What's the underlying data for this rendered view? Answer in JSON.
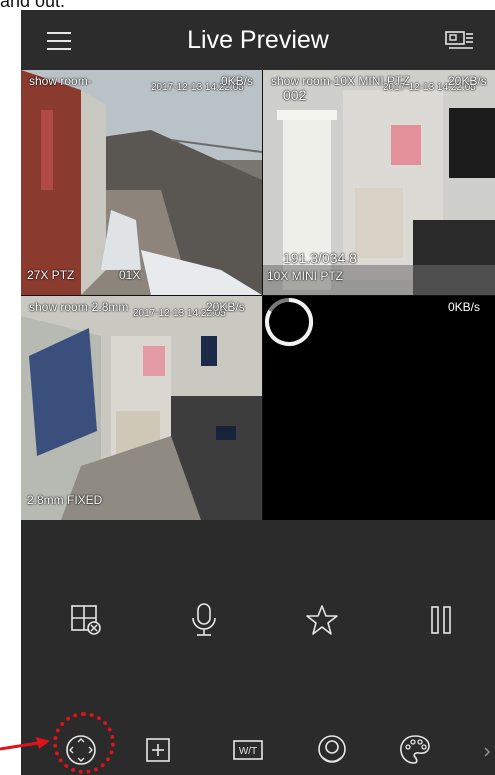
{
  "caption": "and out.",
  "header": {
    "title": "Live Preview",
    "menu_icon": "hamburger-menu-icon",
    "device_icon": "device-list-icon"
  },
  "cameras": [
    {
      "name": "show room-",
      "timestamp": "2017-12-13 14:22:05",
      "bitrate": "0KB/s",
      "label": "27X PTZ",
      "sub_label": "01X"
    },
    {
      "name": "show room-10X MINI PTZ",
      "timestamp": "2017-12-13 14:22:05",
      "bitrate": "20KB/s",
      "channel": "002",
      "label": "10X MINI PTZ",
      "coords": "191.3/034.8"
    },
    {
      "name": "show room-2.8mm",
      "timestamp": "2017-12-13 14:22:05",
      "bitrate": "20KB/s",
      "label": "2.8mm FIXED"
    },
    {
      "name": "",
      "bitrate": "0KB/s",
      "loading": true
    }
  ],
  "controls_row1": [
    {
      "icon": "close-window-icon"
    },
    {
      "icon": "microphone-icon"
    },
    {
      "icon": "star-favorite-icon"
    },
    {
      "icon": "pause-icon"
    }
  ],
  "controls_row2": [
    {
      "icon": "ptz-direction-icon"
    },
    {
      "icon": "fullscreen-split-icon"
    },
    {
      "icon": "zoom-wt-icon",
      "label": "W/T"
    },
    {
      "icon": "fisheye-icon"
    },
    {
      "icon": "color-palette-icon"
    }
  ],
  "colors": {
    "background": "#2b2b2b",
    "highlight": "#e0121b"
  }
}
